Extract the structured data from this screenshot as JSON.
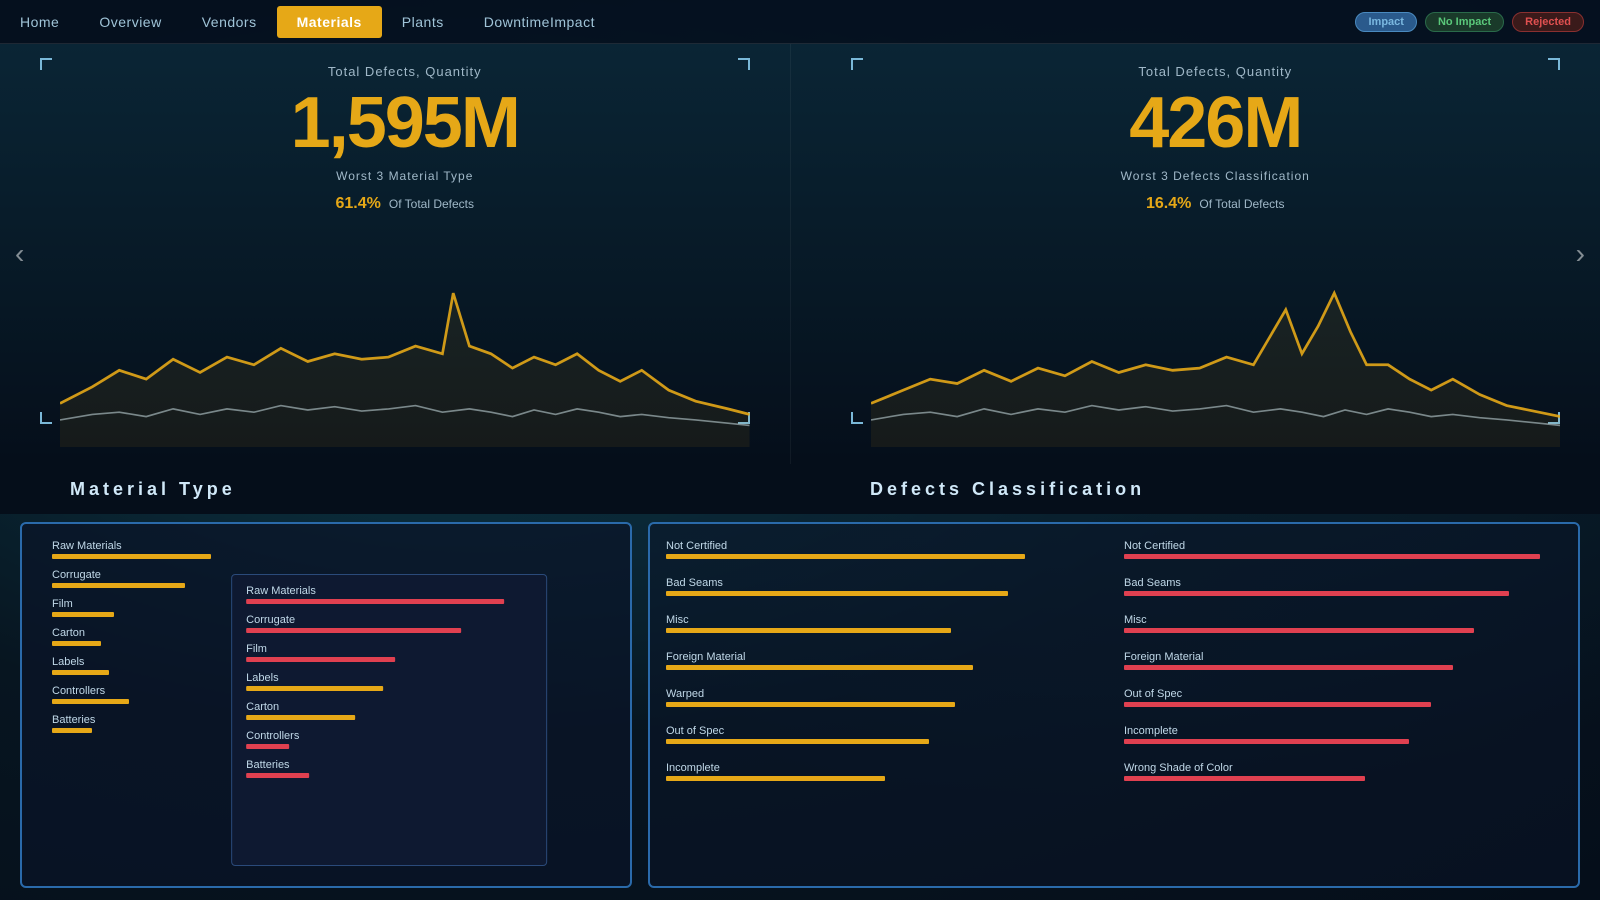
{
  "topBar": {
    "navItems": [
      {
        "id": "home",
        "label": "Home",
        "active": false
      },
      {
        "id": "overview",
        "label": "Overview",
        "active": false
      },
      {
        "id": "vendors",
        "label": "Vendors",
        "active": false
      },
      {
        "id": "materials",
        "label": "Materials",
        "active": true
      },
      {
        "id": "plants",
        "label": "Plants",
        "active": false
      },
      {
        "id": "downtime",
        "label": "DowntimeImpact",
        "active": false
      }
    ],
    "filters": [
      {
        "id": "impact",
        "label": "Impact",
        "type": "impact"
      },
      {
        "id": "no-impact",
        "label": "No Impact",
        "type": "no-impact"
      },
      {
        "id": "rejected",
        "label": "Rejected",
        "type": "rejected"
      }
    ]
  },
  "charts": {
    "left": {
      "title": "Total Defects, Quantity",
      "bigNumber": "1,595M",
      "subtitle1": "Worst 3 Material Type",
      "pct": "61.4%",
      "subtitle2": "Of Total Defects"
    },
    "right": {
      "title": "Total Defects, Quantity",
      "bigNumber": "426M",
      "subtitle1": "Worst 3 Defects Classification",
      "pct": "16.4%",
      "subtitle2": "Of Total Defects"
    }
  },
  "sections": {
    "left": "Material  Type",
    "right": "Defects  Classification"
  },
  "materialType": {
    "columns": {
      "left": [
        {
          "label": "Raw Materials",
          "pct": 72,
          "color": "yellow"
        },
        {
          "label": "Corrugate",
          "pct": 60,
          "color": "yellow"
        },
        {
          "label": "Film",
          "pct": 28,
          "color": "yellow"
        },
        {
          "label": "Carton",
          "pct": 22,
          "color": "yellow"
        },
        {
          "label": "Labels",
          "pct": 26,
          "color": "yellow"
        },
        {
          "label": "Controllers",
          "pct": 35,
          "color": "yellow"
        },
        {
          "label": "Batteries",
          "pct": 18,
          "color": "yellow"
        }
      ],
      "right": [
        {
          "label": "Raw Materials",
          "pct": 90,
          "color": "red"
        },
        {
          "label": "Corrugate",
          "pct": 75,
          "color": "red"
        },
        {
          "label": "Film",
          "pct": 52,
          "color": "red"
        },
        {
          "label": "Labels",
          "pct": 48,
          "color": "yellow"
        },
        {
          "label": "Carton",
          "pct": 38,
          "color": "yellow"
        },
        {
          "label": "Controllers",
          "pct": 15,
          "color": "red"
        },
        {
          "label": "Batteries",
          "pct": 22,
          "color": "red"
        }
      ]
    }
  },
  "defectsClassification": {
    "leftColumn": [
      {
        "label": "Not Certified",
        "pct": 82,
        "color": "yellow"
      },
      {
        "label": "Bad Seams",
        "pct": 78,
        "color": "yellow"
      },
      {
        "label": "Misc",
        "pct": 65,
        "color": "yellow"
      },
      {
        "label": "Foreign Material",
        "pct": 70,
        "color": "yellow"
      },
      {
        "label": "Warped",
        "pct": 66,
        "color": "yellow"
      },
      {
        "label": "Out of Spec",
        "pct": 60,
        "color": "yellow"
      },
      {
        "label": "Incomplete",
        "pct": 50,
        "color": "yellow"
      }
    ],
    "rightColumn": [
      {
        "label": "Not Certified",
        "pct": 95,
        "color": "red"
      },
      {
        "label": "Bad Seams",
        "pct": 88,
        "color": "red"
      },
      {
        "label": "Misc",
        "pct": 80,
        "color": "red"
      },
      {
        "label": "Foreign Material",
        "pct": 75,
        "color": "red"
      },
      {
        "label": "Out of Spec",
        "pct": 70,
        "color": "red"
      },
      {
        "label": "Incomplete",
        "pct": 65,
        "color": "red"
      },
      {
        "label": "Wrong Shade of Color",
        "pct": 55,
        "color": "red"
      }
    ]
  },
  "colors": {
    "accent": "#e6a817",
    "navBg": "#050f1e",
    "panelBg": "#0a1420",
    "borderBlue": "#2a6aaa"
  }
}
